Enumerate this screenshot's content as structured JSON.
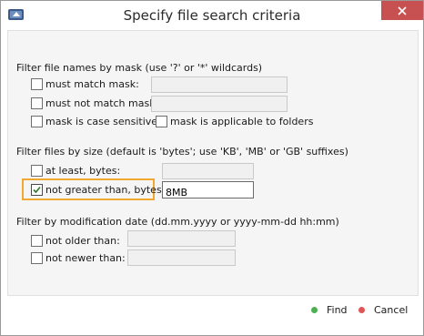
{
  "window": {
    "title": "Specify file search criteria",
    "close_color": "#c75050"
  },
  "mask_section": {
    "heading": "Filter file names by mask (use '?' or '*' wildcards)",
    "must_match_label": "must match mask:",
    "must_match_checked": false,
    "must_match_value": "",
    "must_not_match_label": "must not match mask:",
    "must_not_match_checked": false,
    "must_not_match_value": "",
    "case_sensitive_label": "mask is case sensitive",
    "case_sensitive_checked": false,
    "folders_label": "mask is applicable to folders",
    "folders_checked": false
  },
  "size_section": {
    "heading": "Filter files by size (default is 'bytes'; use 'KB', 'MB' or 'GB' suffixes)",
    "at_least_label": "at least, bytes:",
    "at_least_checked": false,
    "at_least_value": "",
    "not_greater_label": "not greater than, bytes:",
    "not_greater_checked": true,
    "not_greater_value": "8MB",
    "highlight_color": "#f0a830"
  },
  "date_section": {
    "heading": "Filter by modification date (dd.mm.yyyy or yyyy-mm-dd hh:mm)",
    "not_older_label": "not older than:",
    "not_older_checked": false,
    "not_older_value": "",
    "not_newer_label": "not newer than:",
    "not_newer_checked": false,
    "not_newer_value": ""
  },
  "footer": {
    "find_label": "Find",
    "find_color": "#4caf50",
    "cancel_label": "Cancel",
    "cancel_color": "#e05555"
  }
}
